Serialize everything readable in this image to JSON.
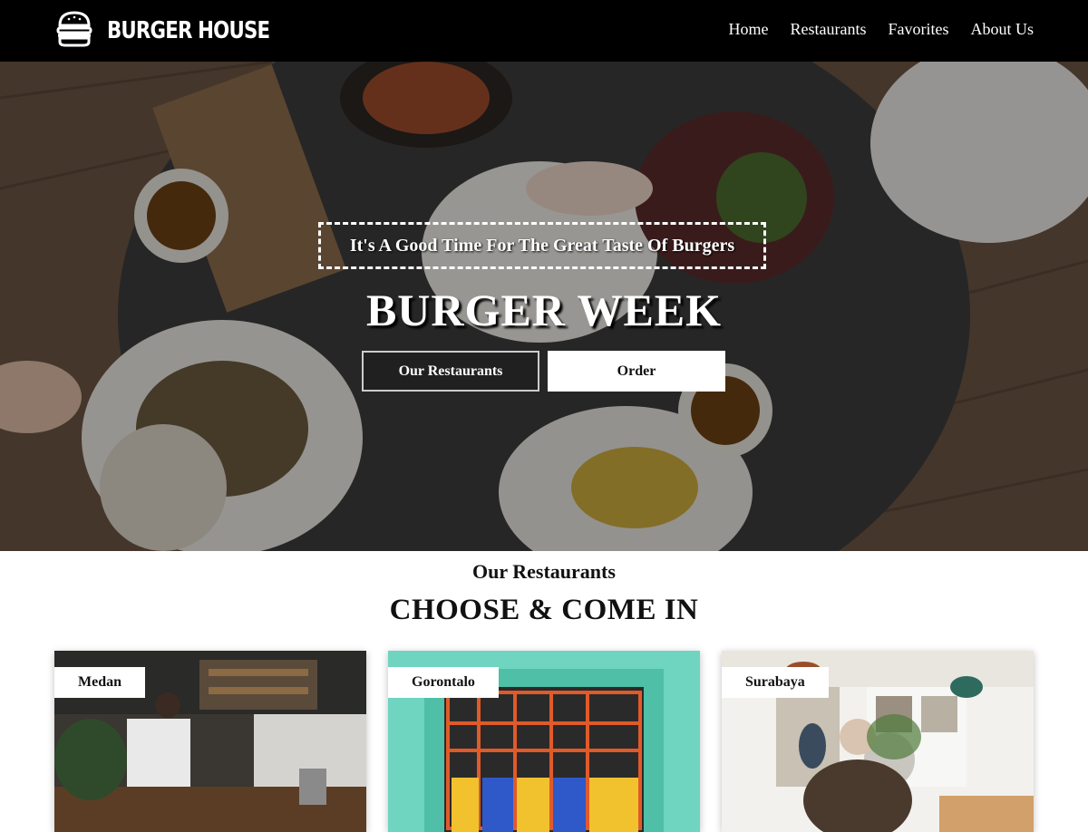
{
  "header": {
    "brand": "BURGER HOUSE",
    "logo_icon": "burger-icon",
    "nav": [
      "Home",
      "Restaurants",
      "Favorites",
      "About Us"
    ]
  },
  "hero": {
    "tagline": "It's A Good Time For The Great Taste Of Burgers",
    "title": "BURGER WEEK",
    "buttons": {
      "restaurants": "Our Restaurants",
      "order": "Order"
    }
  },
  "restaurants": {
    "subtitle": "Our Restaurants",
    "title": "CHOOSE & COME IN",
    "cards": [
      "Medan",
      "Gorontalo",
      "Surabaya"
    ]
  },
  "colors": {
    "header_bg": "#000000",
    "button_bg": "#ffffff",
    "text": "#111111"
  }
}
